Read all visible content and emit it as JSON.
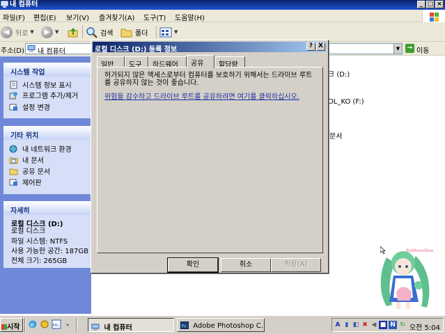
{
  "window": {
    "title": "내 컴퓨터",
    "menu": [
      "파일(F)",
      "편집(E)",
      "보기(V)",
      "즐겨찾기(A)",
      "도구(T)",
      "도움말(H)"
    ],
    "toolbar": {
      "back": "뒤로",
      "search": "검색",
      "folders": "폴더"
    },
    "address": {
      "label": "주소(D)",
      "value": "내 컴퓨터",
      "go": "이동"
    }
  },
  "sidebar": {
    "system_tasks": {
      "title": "시스템 작업",
      "items": [
        "시스템 정보 표시",
        "프로그램 추가/제거",
        "설정 변경"
      ]
    },
    "other_places": {
      "title": "기타 위치",
      "items": [
        "내 네트워크 환경",
        "내 문서",
        "공유 문서",
        "제어판"
      ]
    },
    "details": {
      "title": "자세히",
      "drive_name": "로컬 디스크 (D:)",
      "drive_type": "로컬 디스크",
      "filesystem": "파일 시스템: NTFS",
      "free_space": "사용 가능한 공간: 187GB",
      "total_size": "전체 크기: 265GB"
    }
  },
  "content_fragments": {
    "drive_d": "크 (D:)",
    "drive_f": "OL_KO (F:)",
    "docs": "문서"
  },
  "dialog": {
    "title": "로컬 디스크 (D:) 등록 정보",
    "help": "?",
    "close": "X",
    "tabs": [
      "일반",
      "도구",
      "하드웨어",
      "공유",
      "할당량"
    ],
    "active_tab": "공유",
    "message": "허가되지 않은 액세스로부터 컴퓨터를 보호하기 위해서는 드라이브 루트를 공유하지 않는 것이 좋습니다.",
    "link": "위험을 감수하고 드라이브 루트를 공유하려면 여기를 클릭하십시오.",
    "ok": "확인",
    "cancel": "취소",
    "apply": "적용(A)"
  },
  "taskbar": {
    "start": "시작",
    "tasks": [
      "내 컴퓨터",
      "Adobe Photoshop C..."
    ],
    "tray_lang": "A",
    "clock": "오전 5:04"
  },
  "watermark": "BaMoonline",
  "colors": {
    "title_blue": "#0a246a",
    "sidebar_bg": "#6f89d8",
    "panel_bg": "#d6dff7",
    "link": "#1d2fa6",
    "face": "#d4d0c8"
  }
}
